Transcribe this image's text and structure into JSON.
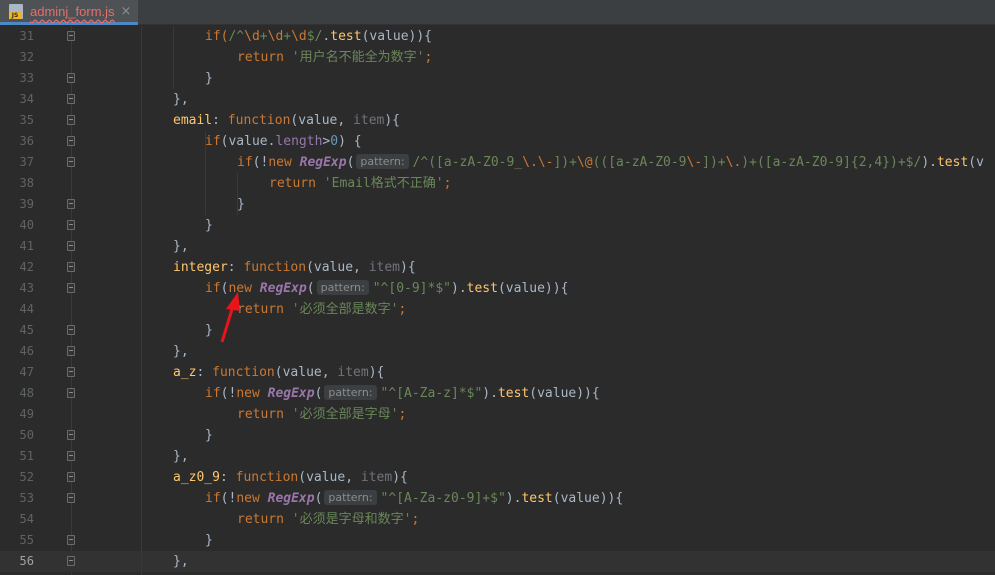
{
  "tab": {
    "file_name": "adminj_form.js",
    "icon": "js-file-icon",
    "icon_badge": "JS",
    "close_glyph": "×"
  },
  "editor": {
    "current_line": 56,
    "lines": [
      {
        "n": "31",
        "indent": 1,
        "tokens": [
          {
            "t": "if(",
            "c": "kw"
          },
          {
            "t": "/^",
            "c": "str"
          },
          {
            "t": "\\d",
            "c": "esc"
          },
          {
            "t": "+",
            "c": "str"
          },
          {
            "t": "\\d",
            "c": "esc"
          },
          {
            "t": "+",
            "c": "str"
          },
          {
            "t": "\\d",
            "c": "esc"
          },
          {
            "t": "$/",
            "c": "str"
          },
          {
            "t": ".",
            "c": ""
          },
          {
            "t": "test",
            "c": "fn"
          },
          {
            "t": "(value)){",
            "c": ""
          }
        ]
      },
      {
        "n": "32",
        "indent": 2,
        "tokens": [
          {
            "t": "return ",
            "c": "kw"
          },
          {
            "t": "'用户名不能全为数字'",
            "c": "str"
          },
          {
            "t": ";",
            "c": "kw"
          }
        ]
      },
      {
        "n": "33",
        "indent": 1,
        "tokens": [
          {
            "t": "}",
            "c": ""
          }
        ]
      },
      {
        "n": "34",
        "indent": 0,
        "tokens": [
          {
            "t": "},",
            "c": ""
          }
        ]
      },
      {
        "n": "35",
        "indent": 0,
        "tokens": [
          {
            "t": "email",
            "c": "fn"
          },
          {
            "t": ": ",
            "c": ""
          },
          {
            "t": "function",
            "c": "kw"
          },
          {
            "t": "(value, ",
            "c": ""
          },
          {
            "t": "item",
            "c": "param"
          },
          {
            "t": "){",
            "c": ""
          }
        ]
      },
      {
        "n": "36",
        "indent": 1,
        "tokens": [
          {
            "t": "if",
            "c": "kw"
          },
          {
            "t": "(value.",
            "c": ""
          },
          {
            "t": "length",
            "c": "prop"
          },
          {
            "t": ">",
            "c": ""
          },
          {
            "t": "0",
            "c": "num"
          },
          {
            "t": ") {",
            "c": ""
          }
        ]
      },
      {
        "n": "37",
        "indent": 2,
        "tokens": [
          {
            "t": "if",
            "c": "kw"
          },
          {
            "t": "(!",
            "c": ""
          },
          {
            "t": "new ",
            "c": "kw"
          },
          {
            "t": "RegExp",
            "c": "cls"
          },
          {
            "t": "(",
            "c": ""
          },
          {
            "t": "pattern:",
            "c": "hint"
          },
          {
            "t": "/^([a-zA-Z0-9_",
            "c": "str"
          },
          {
            "t": "\\.",
            "c": "esc"
          },
          {
            "t": "\\-",
            "c": "esc"
          },
          {
            "t": "])+",
            "c": "str"
          },
          {
            "t": "\\@",
            "c": "esc"
          },
          {
            "t": "(([a-zA-Z0-9",
            "c": "str"
          },
          {
            "t": "\\-",
            "c": "esc"
          },
          {
            "t": "])+",
            "c": "str"
          },
          {
            "t": "\\.",
            "c": "esc"
          },
          {
            "t": ")+([a-zA-Z0-9]{2,4})+$/",
            "c": "str"
          },
          {
            "t": ").",
            "c": ""
          },
          {
            "t": "test",
            "c": "fn"
          },
          {
            "t": "(v",
            "c": ""
          }
        ]
      },
      {
        "n": "38",
        "indent": 3,
        "tokens": [
          {
            "t": "return ",
            "c": "kw"
          },
          {
            "t": "'Email格式不正确'",
            "c": "str"
          },
          {
            "t": ";",
            "c": "kw"
          }
        ]
      },
      {
        "n": "39",
        "indent": 2,
        "tokens": [
          {
            "t": "}",
            "c": ""
          }
        ]
      },
      {
        "n": "40",
        "indent": 1,
        "tokens": [
          {
            "t": "}",
            "c": ""
          }
        ]
      },
      {
        "n": "41",
        "indent": 0,
        "tokens": [
          {
            "t": "},",
            "c": ""
          }
        ]
      },
      {
        "n": "42",
        "indent": 0,
        "tokens": [
          {
            "t": "integer",
            "c": "fn"
          },
          {
            "t": ": ",
            "c": ""
          },
          {
            "t": "function",
            "c": "kw"
          },
          {
            "t": "(value, ",
            "c": ""
          },
          {
            "t": "item",
            "c": "param"
          },
          {
            "t": "){",
            "c": ""
          }
        ]
      },
      {
        "n": "43",
        "indent": 1,
        "tokens": [
          {
            "t": "if",
            "c": "kw"
          },
          {
            "t": "(",
            "c": ""
          },
          {
            "t": "new ",
            "c": "kw"
          },
          {
            "t": "RegExp",
            "c": "cls"
          },
          {
            "t": "(",
            "c": ""
          },
          {
            "t": "pattern:",
            "c": "hint"
          },
          {
            "t": "\"^[0-9]*$\"",
            "c": "str"
          },
          {
            "t": ").",
            "c": ""
          },
          {
            "t": "test",
            "c": "fn"
          },
          {
            "t": "(value)){",
            "c": ""
          }
        ]
      },
      {
        "n": "44",
        "indent": 2,
        "tokens": [
          {
            "t": "return ",
            "c": "kw"
          },
          {
            "t": "'必须全部是数字'",
            "c": "str"
          },
          {
            "t": ";",
            "c": "kw"
          }
        ]
      },
      {
        "n": "45",
        "indent": 1,
        "tokens": [
          {
            "t": "}",
            "c": ""
          }
        ]
      },
      {
        "n": "46",
        "indent": 0,
        "tokens": [
          {
            "t": "},",
            "c": ""
          }
        ]
      },
      {
        "n": "47",
        "indent": 0,
        "tokens": [
          {
            "t": "a_z",
            "c": "fn"
          },
          {
            "t": ": ",
            "c": ""
          },
          {
            "t": "function",
            "c": "kw"
          },
          {
            "t": "(value, ",
            "c": ""
          },
          {
            "t": "item",
            "c": "param"
          },
          {
            "t": "){",
            "c": ""
          }
        ]
      },
      {
        "n": "48",
        "indent": 1,
        "tokens": [
          {
            "t": "if",
            "c": "kw"
          },
          {
            "t": "(!",
            "c": ""
          },
          {
            "t": "new ",
            "c": "kw"
          },
          {
            "t": "RegExp",
            "c": "cls"
          },
          {
            "t": "(",
            "c": ""
          },
          {
            "t": "pattern:",
            "c": "hint"
          },
          {
            "t": "\"^[A-Za-z]*$\"",
            "c": "str"
          },
          {
            "t": ").",
            "c": ""
          },
          {
            "t": "test",
            "c": "fn"
          },
          {
            "t": "(value)){",
            "c": ""
          }
        ]
      },
      {
        "n": "49",
        "indent": 2,
        "tokens": [
          {
            "t": "return ",
            "c": "kw"
          },
          {
            "t": "'必须全部是字母'",
            "c": "str"
          },
          {
            "t": ";",
            "c": "kw"
          }
        ]
      },
      {
        "n": "50",
        "indent": 1,
        "tokens": [
          {
            "t": "}",
            "c": ""
          }
        ]
      },
      {
        "n": "51",
        "indent": 0,
        "tokens": [
          {
            "t": "},",
            "c": ""
          }
        ]
      },
      {
        "n": "52",
        "indent": 0,
        "tokens": [
          {
            "t": "a_z0_9",
            "c": "fn"
          },
          {
            "t": ": ",
            "c": ""
          },
          {
            "t": "function",
            "c": "kw"
          },
          {
            "t": "(value, ",
            "c": ""
          },
          {
            "t": "item",
            "c": "param"
          },
          {
            "t": "){",
            "c": ""
          }
        ]
      },
      {
        "n": "53",
        "indent": 1,
        "tokens": [
          {
            "t": "if",
            "c": "kw"
          },
          {
            "t": "(!",
            "c": ""
          },
          {
            "t": "new ",
            "c": "kw"
          },
          {
            "t": "RegExp",
            "c": "cls"
          },
          {
            "t": "(",
            "c": ""
          },
          {
            "t": "pattern:",
            "c": "hint"
          },
          {
            "t": "\"^[A-Za-z0-9]+$\"",
            "c": "str"
          },
          {
            "t": ").",
            "c": ""
          },
          {
            "t": "test",
            "c": "fn"
          },
          {
            "t": "(value)){",
            "c": ""
          }
        ]
      },
      {
        "n": "54",
        "indent": 2,
        "tokens": [
          {
            "t": "return ",
            "c": "kw"
          },
          {
            "t": "'必须是字母和数字'",
            "c": "str"
          },
          {
            "t": ";",
            "c": "kw"
          }
        ]
      },
      {
        "n": "55",
        "indent": 1,
        "tokens": [
          {
            "t": "}",
            "c": ""
          }
        ]
      },
      {
        "n": "56",
        "indent": 0,
        "tokens": [
          {
            "t": "},",
            "c": ""
          }
        ]
      }
    ]
  },
  "annotation": {
    "icon": "red-arrow-icon",
    "color": "#e8141c"
  }
}
